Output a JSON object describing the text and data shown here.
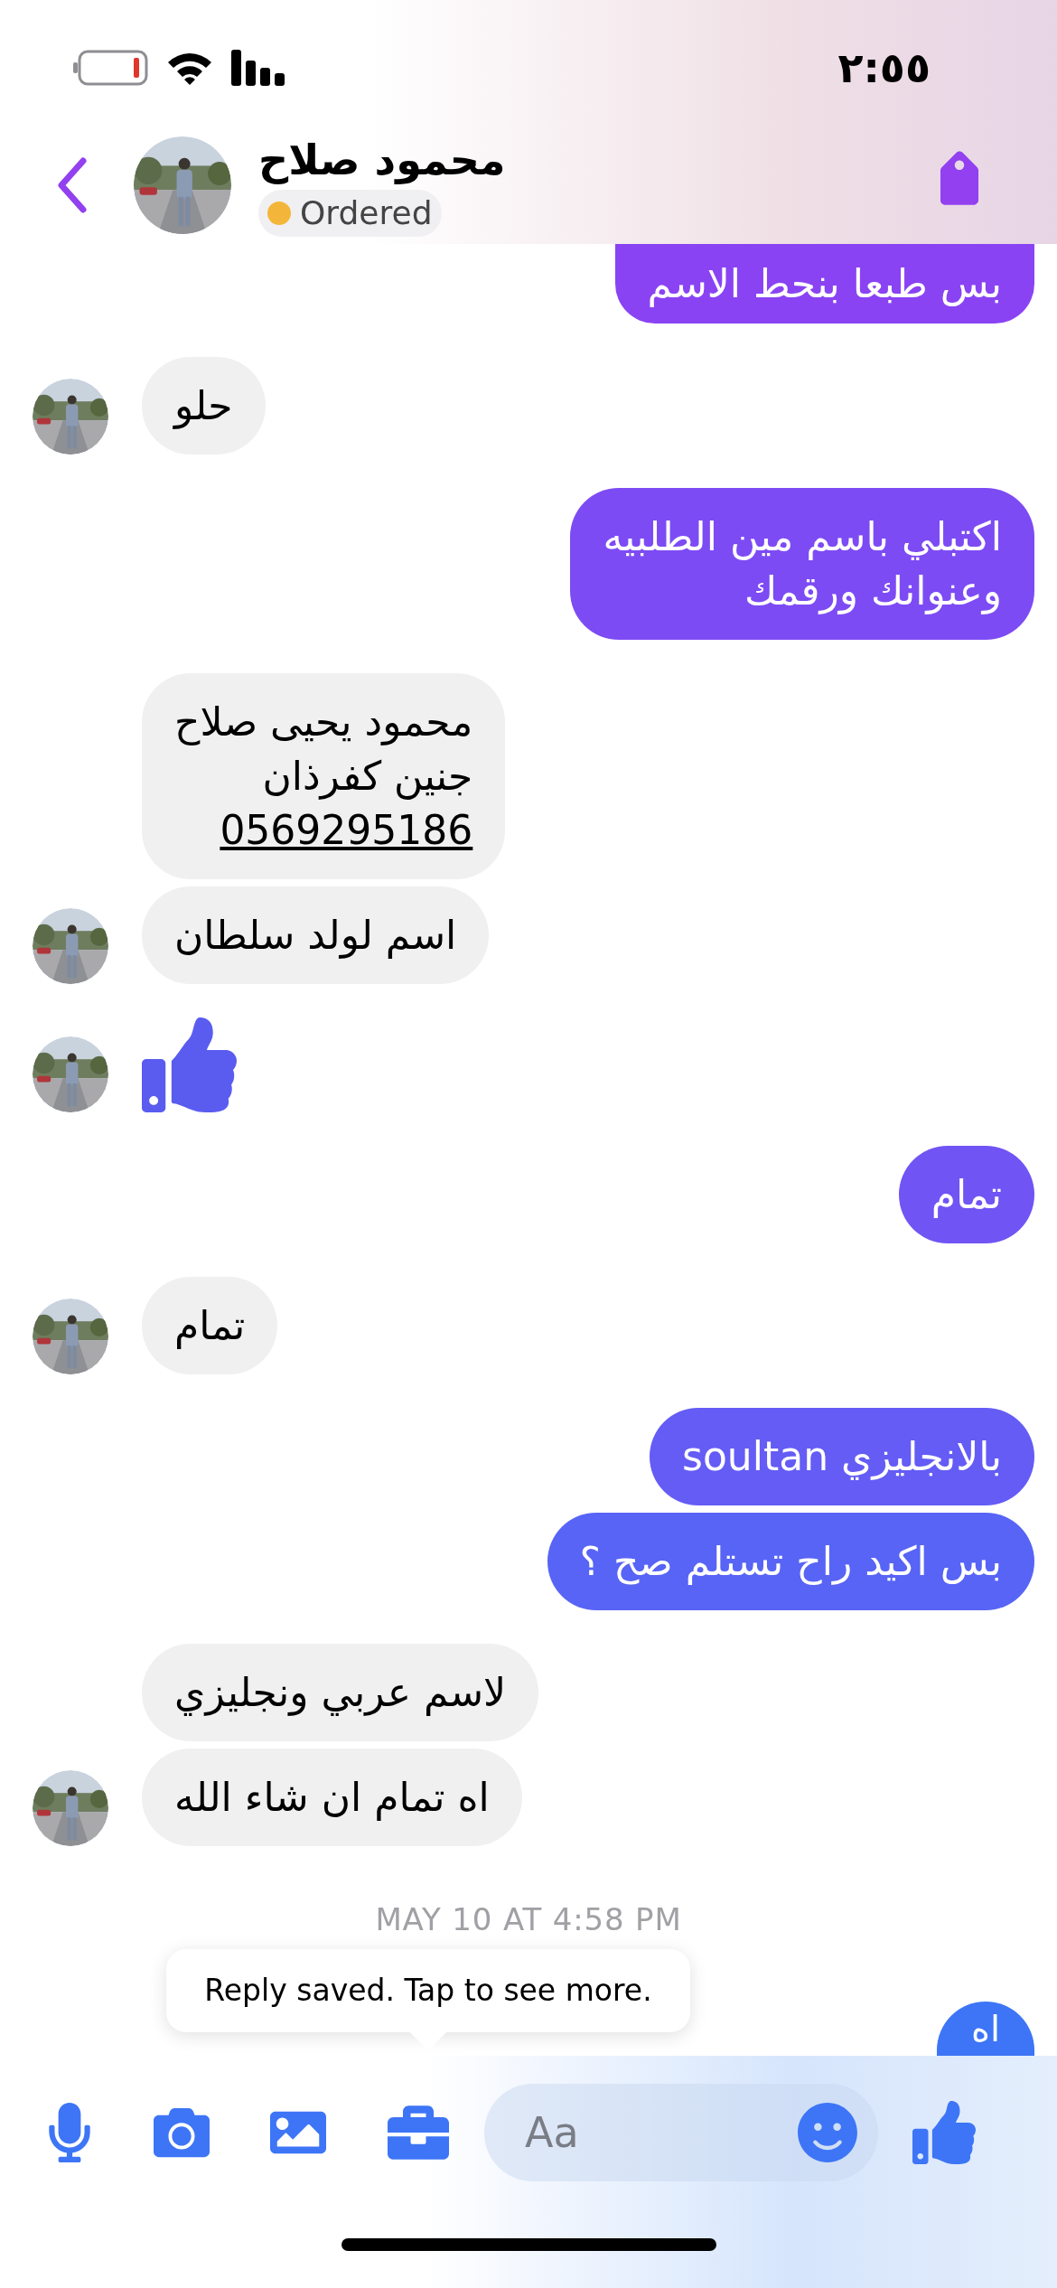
{
  "status_bar": {
    "time": "٢:٥٥"
  },
  "header": {
    "name": "محمود صلاح",
    "label": {
      "text": "Ordered",
      "color": "#f4b63a"
    }
  },
  "partial_top": {
    "text": "بس طبعا بنحط الاسم"
  },
  "messages": [
    {
      "kind": "received",
      "lines": [
        "حلو"
      ]
    },
    {
      "kind": "sent",
      "lines": [
        "اكتبلي باسم مين الطلبيه",
        "وعنوانك ورقمك"
      ]
    },
    {
      "kind": "received",
      "lines": [
        "محمود يحيى صلاح",
        "جنين كفرذان"
      ],
      "phone": "0569295186"
    },
    {
      "kind": "received",
      "lines": [
        "اسم لولد سلطان"
      ]
    },
    {
      "kind": "like"
    },
    {
      "kind": "sent",
      "lines": [
        "تمام"
      ]
    },
    {
      "kind": "received",
      "lines": [
        "تمام"
      ]
    },
    {
      "kind": "sent",
      "lines": [
        "بالانجليزي soultan"
      ]
    },
    {
      "kind": "sent",
      "lines": [
        "بس اكيد راح تستلم صح ؟"
      ]
    },
    {
      "kind": "received",
      "lines": [
        "لاسم عربي ونجليزي"
      ]
    },
    {
      "kind": "received",
      "lines": [
        "اه تمام ان شاء الله"
      ]
    }
  ],
  "timestamp": "MAY 10 AT 4:58 PM",
  "tooltip": "Reply saved. Tap to see more.",
  "partial_bottom": {
    "text": "اه"
  },
  "composer": {
    "placeholder": "Aa"
  }
}
